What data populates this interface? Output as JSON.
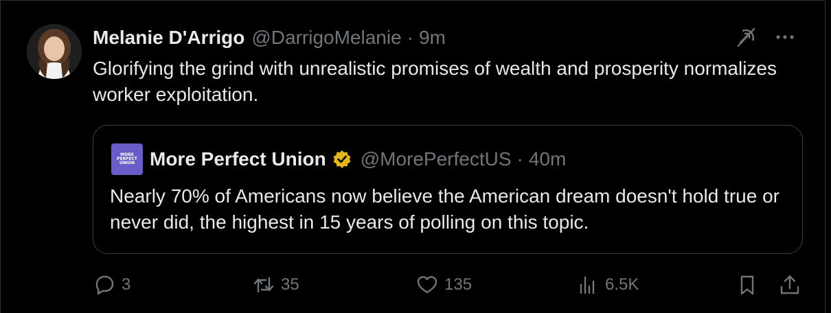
{
  "tweet": {
    "author_name": "Melanie D'Arrigo",
    "author_handle": "@DarrigoMelanie",
    "separator": "·",
    "time": "9m",
    "text": "Glorifying the grind with unrealistic promises of wealth and prosperity normalizes worker exploitation."
  },
  "quote": {
    "logo_lines": [
      "MORE",
      "PERFECT",
      "UNION"
    ],
    "author_name": "More Perfect Union",
    "author_handle": "@MorePerfectUS",
    "separator": "·",
    "time": "40m",
    "text": "Nearly 70% of Americans now believe the American dream doesn't hold true or never did, the highest in 15 years of polling on this topic."
  },
  "actions": {
    "replies": "3",
    "reposts": "35",
    "likes": "135",
    "views": "6.5K"
  },
  "icons": {
    "grok": "grok-icon",
    "more": "more-icon",
    "reply": "reply-icon",
    "repost": "repost-icon",
    "like": "like-icon",
    "views": "views-icon",
    "bookmark": "bookmark-icon",
    "share": "share-icon",
    "verified": "verified-badge-icon"
  },
  "colors": {
    "background": "#000000",
    "text_primary": "#e7e9ea",
    "text_secondary": "#71767b",
    "border": "#2f3336",
    "verified_gold": "#e2b719",
    "union_logo_purple": "#6b5dc7"
  }
}
